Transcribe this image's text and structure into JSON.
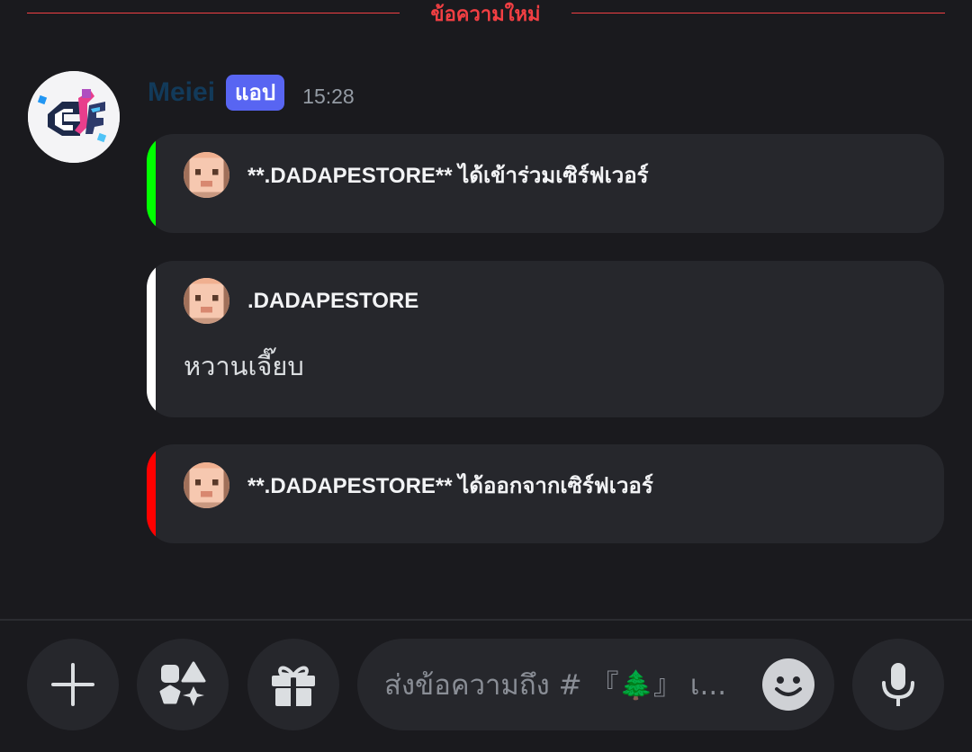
{
  "divider": {
    "label": "ข้อความใหม่"
  },
  "message": {
    "username": "Meiei",
    "badge": "แอป",
    "timestamp": "15:28",
    "embeds": [
      {
        "author": "**.DADAPESTORE** ได้เข้าร่วมเซิร์ฟเวอร์",
        "description": "",
        "bar_color": "#00ff00"
      },
      {
        "author": ".DADAPESTORE",
        "description": "หวานเจี๊ยบ",
        "bar_color": "#ffffff"
      },
      {
        "author": "**.DADAPESTORE** ได้ออกจากเซิร์ฟเวอร์",
        "description": "",
        "bar_color": "#ff0000"
      }
    ]
  },
  "composer": {
    "placeholder": "ส่งข้อความถึง # 『🌲』 เ...",
    "buttons": [
      "plus-icon",
      "apps-icon",
      "gift-icon",
      "emoji-icon",
      "microphone-icon"
    ]
  },
  "colors": {
    "background": "#1a1a1e",
    "panel": "#26272c",
    "accent": "#5865f2",
    "new_divider": "#f23f43"
  }
}
